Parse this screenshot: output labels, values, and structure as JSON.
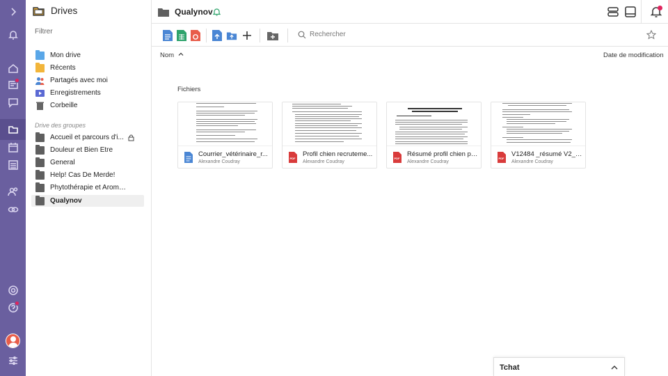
{
  "rail": {
    "icons": [
      "chevron-right-icon",
      "bell-icon",
      "home-icon",
      "newspaper-icon",
      "message-icon",
      "drive-icon",
      "calendar-icon",
      "list-icon",
      "users-icon",
      "link-icon",
      "settings-icon",
      "help-icon",
      "avatar",
      "sliders-icon"
    ]
  },
  "sidebar": {
    "title": "Drives",
    "filter_placeholder": "Filtrer",
    "items": [
      {
        "label": "Mon drive"
      },
      {
        "label": "Récents"
      },
      {
        "label": "Partagés avec moi"
      },
      {
        "label": "Enregistrements"
      },
      {
        "label": "Corbeille"
      }
    ],
    "group_section": "Drive des groupes",
    "groups": [
      {
        "label": "Accueil et parcours d'i..."
      },
      {
        "label": "Douleur et Bien Etre"
      },
      {
        "label": "General"
      },
      {
        "label": "Help! Cas De Merde!"
      },
      {
        "label": "Phytothérapie et Aromat..."
      },
      {
        "label": "Qualynov"
      }
    ]
  },
  "header": {
    "title": "Qualynov"
  },
  "toolbar": {
    "search_placeholder": "Rechercher"
  },
  "list": {
    "col_name": "Nom",
    "col_date": "Date de modification",
    "section": "Fichiers"
  },
  "files": [
    {
      "name": "Courrier_vétérinaire_r...",
      "owner": "Alexandre Coudray",
      "type": "doc"
    },
    {
      "name": "Profil chien recruteme...",
      "owner": "Alexandre Coudray",
      "type": "pdf"
    },
    {
      "name": "Résumé profil chien po...",
      "owner": "Alexandre Coudray",
      "type": "pdf"
    },
    {
      "name": "V12484 _résumé V2_2...",
      "owner": "Alexandre Coudray",
      "type": "pdf"
    }
  ],
  "chat": {
    "label": "Tchat"
  },
  "colors": {
    "rail": "#6a5f9f",
    "accent_green": "#2ea36b",
    "notification": "#e0245e",
    "pdf_red": "#d93b3b",
    "doc_blue": "#4a86d4"
  }
}
